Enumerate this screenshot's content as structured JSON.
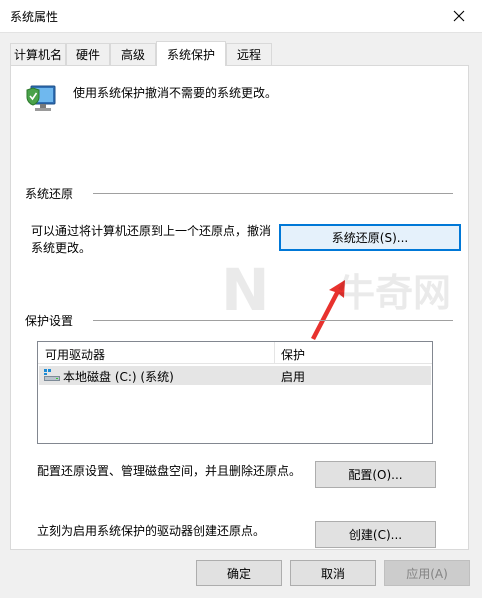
{
  "window": {
    "title": "系统属性"
  },
  "tabs": [
    {
      "label": "计算机名"
    },
    {
      "label": "硬件"
    },
    {
      "label": "高级"
    },
    {
      "label": "系统保护",
      "active": true
    },
    {
      "label": "远程"
    }
  ],
  "intro": {
    "text": "使用系统保护撤消不需要的系统更改。"
  },
  "restore": {
    "section_label": "系统还原",
    "desc_line1": "可以通过将计算机还原到上一个还原点，撤消",
    "desc_line2": "系统更改。",
    "button_label": "系统还原(S)..."
  },
  "protection": {
    "section_label": "保护设置",
    "columns": [
      "可用驱动器",
      "保护"
    ],
    "rows": [
      {
        "drive": "本地磁盘 (C:) (系统)",
        "protection": "启用"
      }
    ],
    "configure_desc": "配置还原设置、管理磁盘空间，并且删除还原点。",
    "configure_button": "配置(O)...",
    "create_desc": "立刻为启用系统保护的驱动器创建还原点。",
    "create_button": "创建(C)..."
  },
  "footer": {
    "ok": "确定",
    "cancel": "取消",
    "apply": "应用(A)"
  },
  "colors": {
    "focus_border": "#0078d7",
    "arrow": "#e8322e",
    "dialog_bg": "#f0f0f0"
  },
  "watermark": {
    "logo_letter": "N",
    "brand_text": "牛奇网"
  }
}
